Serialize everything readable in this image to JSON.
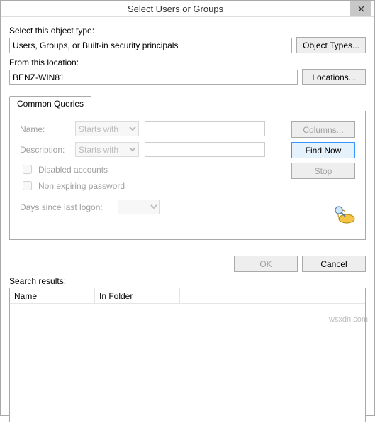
{
  "window": {
    "title": "Select Users or Groups"
  },
  "labels": {
    "object_type": "Select this object type:",
    "from_location": "From this location:",
    "search_results": "Search results:"
  },
  "fields": {
    "object_type_value": "Users, Groups, or Built-in security principals",
    "location_value": "BENZ-WIN81"
  },
  "buttons": {
    "object_types": "Object Types...",
    "locations": "Locations...",
    "columns": "Columns...",
    "find_now": "Find Now",
    "stop": "Stop",
    "ok": "OK",
    "cancel": "Cancel"
  },
  "tabs": {
    "common_queries": "Common Queries"
  },
  "queries": {
    "name_label": "Name:",
    "description_label": "Description:",
    "name_combo": "Starts with",
    "description_combo": "Starts with",
    "disabled_accounts": "Disabled accounts",
    "non_expiring": "Non expiring password",
    "days_logon": "Days since last logon:"
  },
  "grid": {
    "col_name": "Name",
    "col_folder": "In Folder"
  },
  "watermark": "wsxdn.com"
}
